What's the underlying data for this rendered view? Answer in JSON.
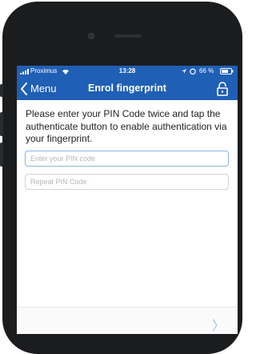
{
  "status": {
    "carrier": "Proximus",
    "time": "13:28",
    "battery": "66 %"
  },
  "nav": {
    "back_label": "Menu",
    "title": "Enrol fingerprint"
  },
  "content": {
    "instruction": "Please enter your PIN Code twice and tap the authenticate button to enable authentication via your fingerprint.",
    "pin_placeholder": "Enter your PIN code",
    "repeat_placeholder": "Repeat PIN Code"
  },
  "colors": {
    "accent": "#1f5fb5",
    "field_focus_border": "#8fb3e3"
  },
  "icons": [
    "signal-icon",
    "wifi-icon",
    "location-icon",
    "alarm-icon",
    "battery-icon",
    "back-chevron-icon",
    "lock-icon",
    "next-chevron-icon"
  ]
}
